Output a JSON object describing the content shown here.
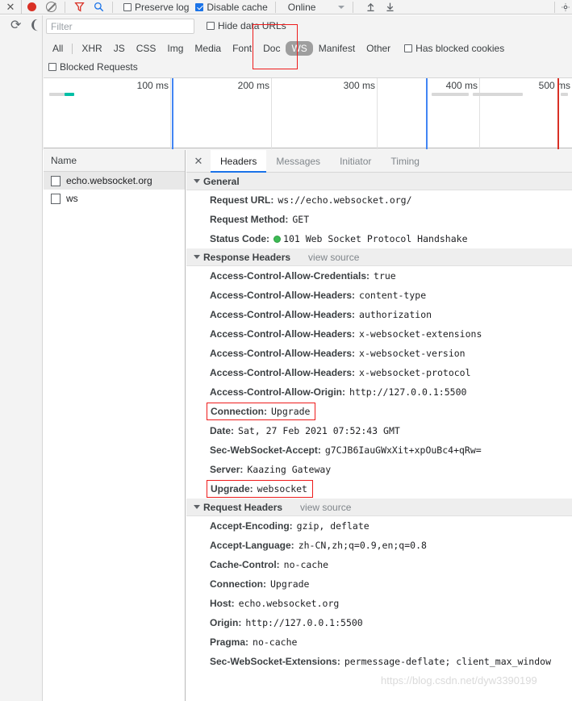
{
  "toolbar": {
    "close_label": "✕",
    "record_icon": "record-circle-icon",
    "clear_icon": "clear-icon",
    "filter_icon": "funnel-icon",
    "search_icon": "search-icon",
    "preserve_log_label": "Preserve log",
    "preserve_log_checked": false,
    "disable_cache_label": "Disable cache",
    "disable_cache_checked": true,
    "throttling_value": "Online",
    "import_icon": "import-har-icon",
    "export_icon": "export-har-icon",
    "settings_icon": "gear-icon"
  },
  "filterbar": {
    "reload_icon": "reload-icon",
    "filter_placeholder": "Filter",
    "filter_value": "",
    "hide_data_urls_label": "Hide data URLs",
    "hide_data_urls_checked": false,
    "blocked_requests_label": "Blocked Requests",
    "blocked_requests_checked": false,
    "has_blocked_cookies_label": "Has blocked cookies",
    "has_blocked_cookies_checked": false,
    "types": [
      {
        "label": "All",
        "active": false
      },
      {
        "label": "XHR",
        "active": false
      },
      {
        "label": "JS",
        "active": false
      },
      {
        "label": "CSS",
        "active": false
      },
      {
        "label": "Img",
        "active": false
      },
      {
        "label": "Media",
        "active": false
      },
      {
        "label": "Font",
        "active": false
      },
      {
        "label": "Doc",
        "active": false
      },
      {
        "label": "WS",
        "active": true
      },
      {
        "label": "Manifest",
        "active": false
      },
      {
        "label": "Other",
        "active": false
      }
    ],
    "highlight_color": "#ee1c1c"
  },
  "overview": {
    "ticks": [
      {
        "label": "100 ms",
        "x_pct": 24.0
      },
      {
        "label": "200 ms",
        "x_pct": 43.0
      },
      {
        "label": "300 ms",
        "x_pct": 63.0
      },
      {
        "label": "400 ms",
        "x_pct": 82.5
      },
      {
        "label": "500 ms",
        "x_pct": 100.0
      }
    ],
    "events": [
      {
        "name": "dom-content-loaded",
        "x_pct": 24.2,
        "color": "#4285f4"
      },
      {
        "name": "dom-content-loaded-2",
        "x_pct": 72.3,
        "color": "#4285f4"
      },
      {
        "name": "load",
        "x_pct": 97.2,
        "color": "#d93025"
      }
    ],
    "bars": [
      {
        "name": "bar-queued",
        "x_pct": 1.0,
        "w_pct": 3.2,
        "color": "#d8d8d8",
        "y": 18
      },
      {
        "name": "bar-websocket",
        "x_pct": 4.0,
        "w_pct": 1.8,
        "color": "#00bfa5",
        "y": 18
      },
      {
        "name": "bar-req-a",
        "x_pct": 73.4,
        "w_pct": 7.0,
        "color": "#d8d8d8",
        "y": 18
      },
      {
        "name": "bar-req-b",
        "x_pct": 81.2,
        "w_pct": 9.5,
        "color": "#d8d8d8",
        "y": 18
      },
      {
        "name": "bar-req-c",
        "x_pct": 97.8,
        "w_pct": 1.4,
        "color": "#d8d8d8",
        "y": 18
      }
    ]
  },
  "requests": {
    "column_header": "Name",
    "rows": [
      {
        "name": "echo.websocket.org",
        "selected": true
      },
      {
        "name": "ws",
        "selected": false
      }
    ]
  },
  "details": {
    "close_label": "✕",
    "tabs": [
      {
        "label": "Headers",
        "active": true
      },
      {
        "label": "Messages",
        "active": false
      },
      {
        "label": "Initiator",
        "active": false
      },
      {
        "label": "Timing",
        "active": false
      }
    ],
    "sections": [
      {
        "title": "General",
        "view_source": "",
        "rows": [
          {
            "name": "Request URL:",
            "value": "ws://echo.websocket.org/",
            "boxed": false,
            "status_dot": false
          },
          {
            "name": "Request Method:",
            "value": "GET",
            "boxed": false,
            "status_dot": false
          },
          {
            "name": "Status Code:",
            "value": "101 Web Socket Protocol Handshake",
            "boxed": false,
            "status_dot": true
          }
        ]
      },
      {
        "title": "Response Headers",
        "view_source": "view source",
        "rows": [
          {
            "name": "Access-Control-Allow-Credentials:",
            "value": "true",
            "boxed": false,
            "status_dot": false
          },
          {
            "name": "Access-Control-Allow-Headers:",
            "value": "content-type",
            "boxed": false,
            "status_dot": false
          },
          {
            "name": "Access-Control-Allow-Headers:",
            "value": "authorization",
            "boxed": false,
            "status_dot": false
          },
          {
            "name": "Access-Control-Allow-Headers:",
            "value": "x-websocket-extensions",
            "boxed": false,
            "status_dot": false
          },
          {
            "name": "Access-Control-Allow-Headers:",
            "value": "x-websocket-version",
            "boxed": false,
            "status_dot": false
          },
          {
            "name": "Access-Control-Allow-Headers:",
            "value": "x-websocket-protocol",
            "boxed": false,
            "status_dot": false
          },
          {
            "name": "Access-Control-Allow-Origin:",
            "value": "http://127.0.0.1:5500",
            "boxed": false,
            "status_dot": false
          },
          {
            "name": "Connection:",
            "value": "Upgrade",
            "boxed": true,
            "status_dot": false
          },
          {
            "name": "Date:",
            "value": "Sat, 27 Feb 2021 07:52:43 GMT",
            "boxed": false,
            "status_dot": false
          },
          {
            "name": "Sec-WebSocket-Accept:",
            "value": "g7CJB6IauGWxXit+xpOuBc4+qRw=",
            "boxed": false,
            "status_dot": false
          },
          {
            "name": "Server:",
            "value": "Kaazing Gateway",
            "boxed": false,
            "status_dot": false
          },
          {
            "name": "Upgrade:",
            "value": "websocket",
            "boxed": true,
            "status_dot": false
          }
        ]
      },
      {
        "title": "Request Headers",
        "view_source": "view source",
        "rows": [
          {
            "name": "Accept-Encoding:",
            "value": "gzip, deflate",
            "boxed": false,
            "status_dot": false
          },
          {
            "name": "Accept-Language:",
            "value": "zh-CN,zh;q=0.9,en;q=0.8",
            "boxed": false,
            "status_dot": false
          },
          {
            "name": "Cache-Control:",
            "value": "no-cache",
            "boxed": false,
            "status_dot": false
          },
          {
            "name": "Connection:",
            "value": "Upgrade",
            "boxed": false,
            "status_dot": false
          },
          {
            "name": "Host:",
            "value": "echo.websocket.org",
            "boxed": false,
            "status_dot": false
          },
          {
            "name": "Origin:",
            "value": "http://127.0.0.1:5500",
            "boxed": false,
            "status_dot": false
          },
          {
            "name": "Pragma:",
            "value": "no-cache",
            "boxed": false,
            "status_dot": false
          },
          {
            "name": "Sec-WebSocket-Extensions:",
            "value": "permessage-deflate; client_max_window",
            "boxed": false,
            "status_dot": false
          }
        ]
      }
    ]
  },
  "watermark": {
    "text": "https://blog.csdn.net/dyw3390199"
  }
}
